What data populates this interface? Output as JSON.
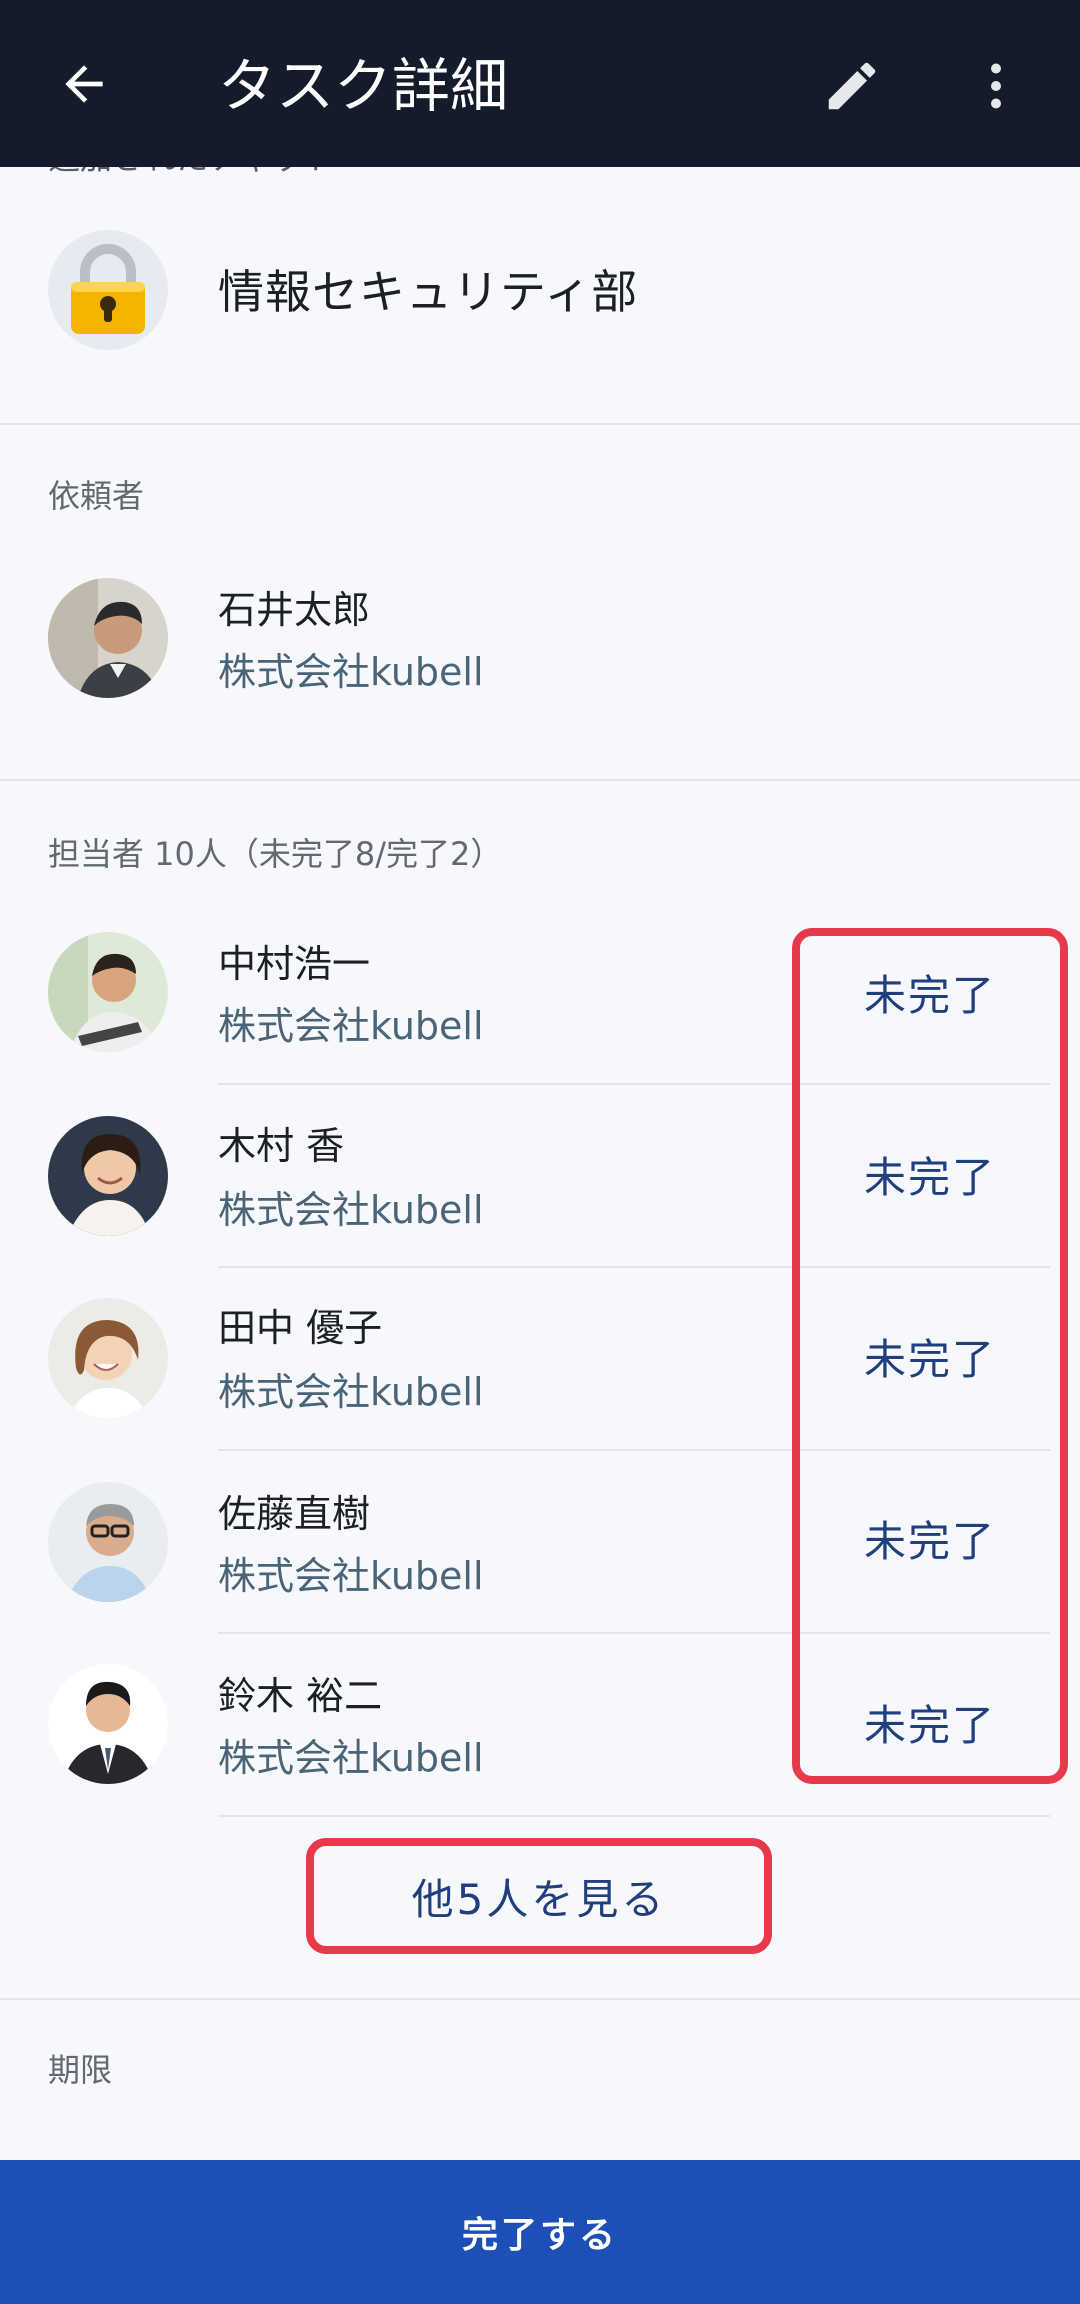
{
  "appbar": {
    "title": "タスク詳細",
    "back_icon": "arrow-left-icon",
    "edit_icon": "pencil-icon",
    "more_icon": "more-vertical-icon"
  },
  "partial_label": "追加されたチャット",
  "project": {
    "name": "情報セキュリティ部",
    "icon": "lock-icon"
  },
  "requester": {
    "label": "依頼者",
    "name": "石井太郎",
    "company": "株式会社kubell"
  },
  "assignees": {
    "label": "担当者 10人（未完了8/完了2）",
    "items": [
      {
        "name": "中村浩一",
        "company": "株式会社kubell",
        "status": "未完了"
      },
      {
        "name": "木村 香",
        "company": "株式会社kubell",
        "status": "未完了"
      },
      {
        "name": "田中 優子",
        "company": "株式会社kubell",
        "status": "未完了"
      },
      {
        "name": "佐藤直樹",
        "company": "株式会社kubell",
        "status": "未完了"
      },
      {
        "name": "鈴木 裕二",
        "company": "株式会社kubell",
        "status": "未完了"
      }
    ],
    "see_more_label": "他5人を見る"
  },
  "deadline": {
    "label": "期限"
  },
  "complete_button_label": "完了する",
  "colors": {
    "appbar_bg": "#141c2b",
    "accent_blue": "#1d4fb6",
    "status_text": "#213f7c",
    "highlight_red": "#e8394a"
  }
}
